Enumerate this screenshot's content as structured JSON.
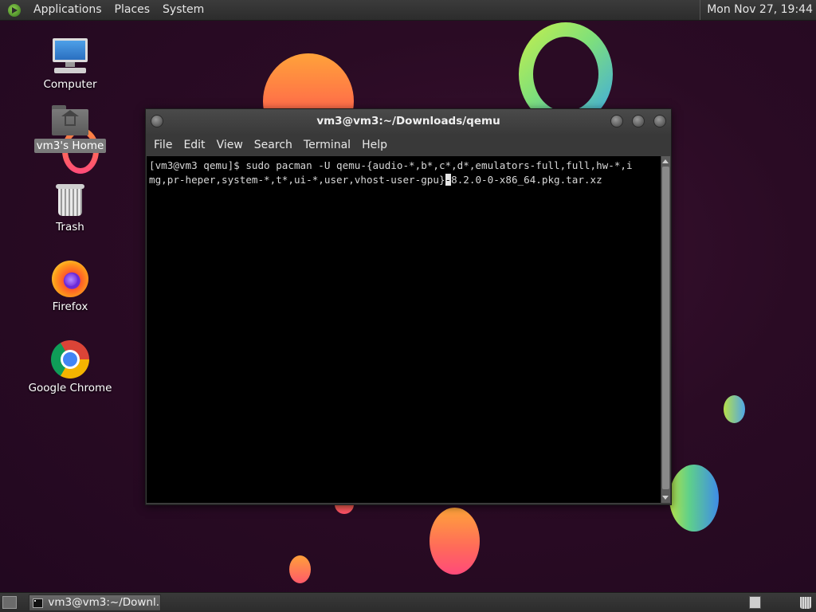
{
  "top_panel": {
    "menus": [
      "Applications",
      "Places",
      "System"
    ],
    "clock": "Mon Nov 27, 19:44"
  },
  "desktop_icons": [
    {
      "label": "Computer",
      "icon": "computer-icon"
    },
    {
      "label": "vm3's Home",
      "icon": "home-folder-icon"
    },
    {
      "label": "Trash",
      "icon": "trash-icon"
    },
    {
      "label": "Firefox",
      "icon": "firefox-icon"
    },
    {
      "label": "Google Chrome",
      "icon": "chrome-icon"
    }
  ],
  "terminal": {
    "title": "vm3@vm3:~/Downloads/qemu",
    "menus": [
      "File",
      "Edit",
      "View",
      "Search",
      "Terminal",
      "Help"
    ],
    "lines": [
      "[vm3@vm3 qemu]$ sudo pacman -U qemu-{audio-*,b*,c*,d*,emulators-full,full,hw-*,i",
      "mg,pr-heper,system-*,t*,ui-*,user,vhost-user-gpu}"
    ],
    "cursor_char": "-",
    "after_cursor": "8.2.0-0-x86_64.pkg.tar.xz"
  },
  "taskbar": {
    "task_label": "vm3@vm3:~/Downl..."
  },
  "colors": {
    "desktop_bg": "#2a0b24",
    "panel_bg": "#2c2c2c",
    "terminal_bg": "#000000",
    "terminal_fg": "#d8d8d8"
  }
}
